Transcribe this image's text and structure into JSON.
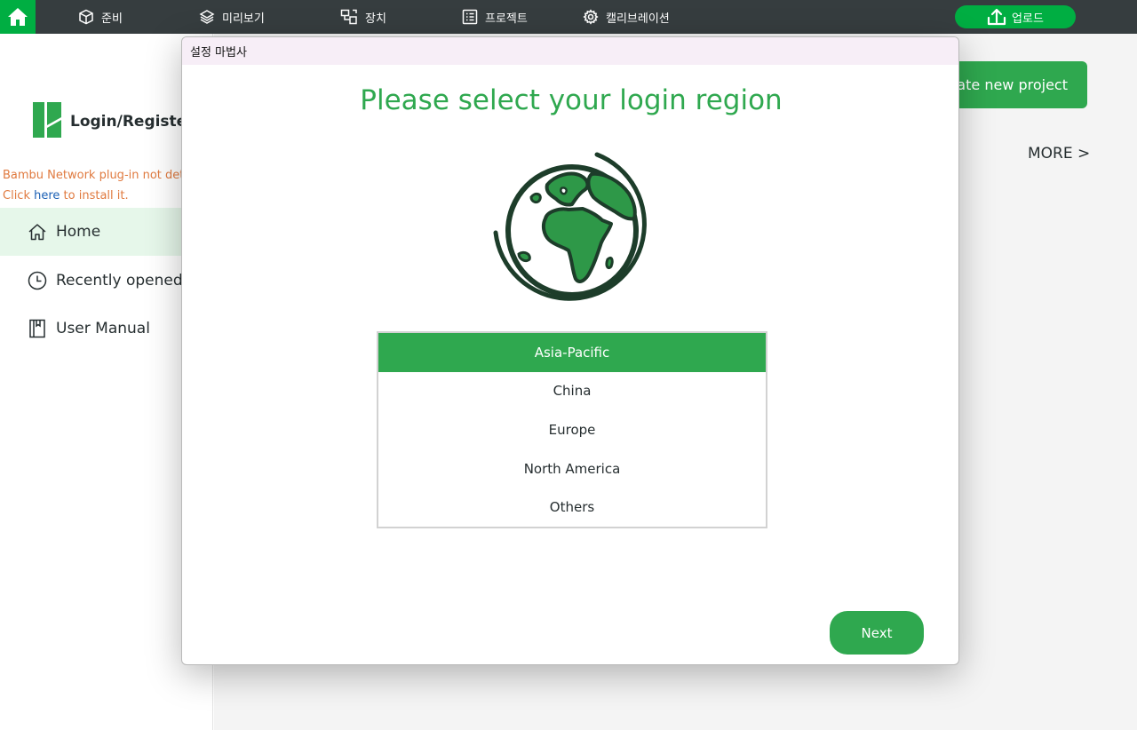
{
  "toolbar": {
    "tabs": [
      {
        "label": "준비"
      },
      {
        "label": "미리보기"
      },
      {
        "label": "장치"
      },
      {
        "label": "프로젝트"
      },
      {
        "label": "캘리브레이션"
      }
    ],
    "upload_label": "업로드"
  },
  "sidebar": {
    "login_label": "Login/Register",
    "plugin_warning_line1": "Bambu Network plug-in not detec",
    "plugin_warning_prefix": "Click ",
    "plugin_warning_link": "here",
    "plugin_warning_suffix": " to install it.",
    "nav": [
      {
        "label": "Home"
      },
      {
        "label": "Recently opened"
      },
      {
        "label": "User Manual"
      }
    ]
  },
  "main": {
    "create_project_label": "reate new project",
    "more_label": "MORE  >"
  },
  "dialog": {
    "title": "설정 마법사",
    "heading": "Please select your login region",
    "regions": [
      {
        "label": "Asia-Pacific",
        "selected": true
      },
      {
        "label": "China"
      },
      {
        "label": "Europe"
      },
      {
        "label": "North America"
      },
      {
        "label": "Others"
      }
    ],
    "next_label": "Next"
  },
  "colors": {
    "accent": "#00ae42",
    "button_green": "#2fa84f",
    "toolbar_bg": "#363d3f",
    "warning": "#e07a3f",
    "link": "#1a5fb4"
  }
}
